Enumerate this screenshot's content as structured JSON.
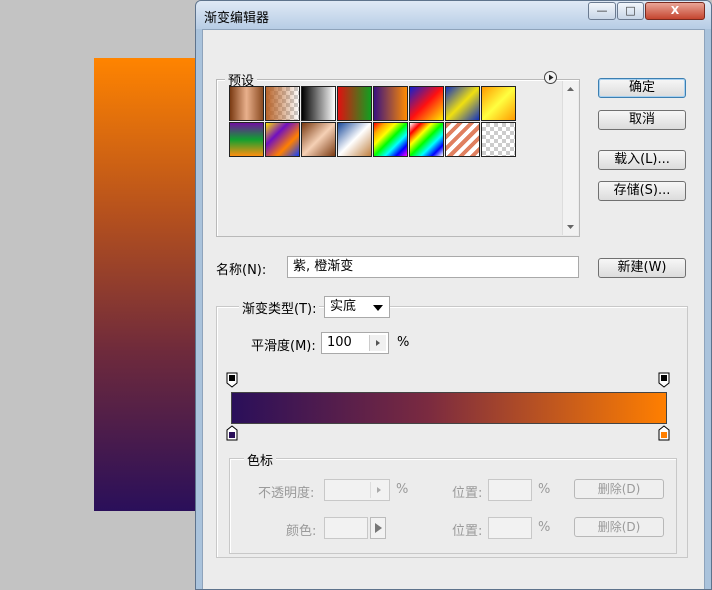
{
  "dialog": {
    "title": "渐变编辑器"
  },
  "window_controls": {
    "minimize": "—",
    "maximize": "□",
    "close": "X"
  },
  "presets": {
    "legend": "预设",
    "menu_icon": "play-circle-icon",
    "swatches": [
      {
        "name": "copper-1",
        "bg": "linear-gradient(90deg,#7a3a12,#e9b08c,#8a4a20)"
      },
      {
        "name": "copper-transparent",
        "bg": "linear-gradient(90deg,#b8642a,rgba(255,255,255,0))"
      },
      {
        "name": "black-white",
        "bg": "linear-gradient(90deg,#000,#fff)"
      },
      {
        "name": "red-green",
        "bg": "linear-gradient(90deg,#e01010,#10a020)"
      },
      {
        "name": "violet-orange",
        "bg": "linear-gradient(90deg,#3a1280,#ff8c00)"
      },
      {
        "name": "blue-red-yellow",
        "bg": "linear-gradient(135deg,#1020d0,#ff1010,#ffee00)"
      },
      {
        "name": "blue-yellow-blue",
        "bg": "linear-gradient(135deg,#1030c0,#f0e010,#1030c0)"
      },
      {
        "name": "orange-yellow-orange",
        "bg": "linear-gradient(135deg,#ff9a00,#ffff40,#ff9a00)"
      },
      {
        "name": "violet-green-orange",
        "bg": "linear-gradient(180deg,#7010a0,#10a030,#ff9010)"
      },
      {
        "name": "yellow-violet-orange-blue",
        "bg": "linear-gradient(135deg,#ffe000,#7010c0,#ff8000,#1040ff)"
      },
      {
        "name": "copper-2",
        "bg": "linear-gradient(135deg,#7a3a12,#f5d0b5,#7a3a12)"
      },
      {
        "name": "chrome",
        "bg": "linear-gradient(135deg,#1a4a9a,#fff 50%,#c08040)"
      },
      {
        "name": "spectrum",
        "bg": "linear-gradient(135deg,red,orange,yellow,lime,cyan,blue,magenta)"
      },
      {
        "name": "transparent-rainbow",
        "bg": "linear-gradient(135deg,#fff,red,yellow,lime,cyan,blue,#fff)"
      },
      {
        "name": "transparent-stripes",
        "bg": "repeating-linear-gradient(135deg,#e08060 0 4px,#fff 4px 8px)"
      },
      {
        "name": "foreground-transparent",
        "bg": "linear-gradient(90deg,rgba(255,255,255,0),rgba(255,255,255,0))"
      }
    ]
  },
  "buttons": {
    "ok": "确定",
    "cancel": "取消",
    "load": "载入(L)...",
    "save": "存储(S)...",
    "new": "新建(W)"
  },
  "name_field": {
    "label": "名称(N):",
    "value": "紫, 橙渐变"
  },
  "gradient": {
    "type_label": "渐变类型(T):",
    "type_value": "实底",
    "smoothness_label": "平滑度(M):",
    "smoothness_value": "100",
    "smoothness_unit": "%",
    "start_color": "#2a0f5a",
    "mid_color": "#7a2a40",
    "end_color": "#ff7f00",
    "opacity_stop_color": "#000000"
  },
  "stops": {
    "legend": "色标",
    "opacity_label": "不透明度:",
    "opacity_unit": "%",
    "color_label": "颜色:",
    "location_label_1": "位置:",
    "location_label_2": "位置:",
    "location_unit_1": "%",
    "location_unit_2": "%",
    "delete_1": "删除(D)",
    "delete_2": "删除(D)"
  }
}
